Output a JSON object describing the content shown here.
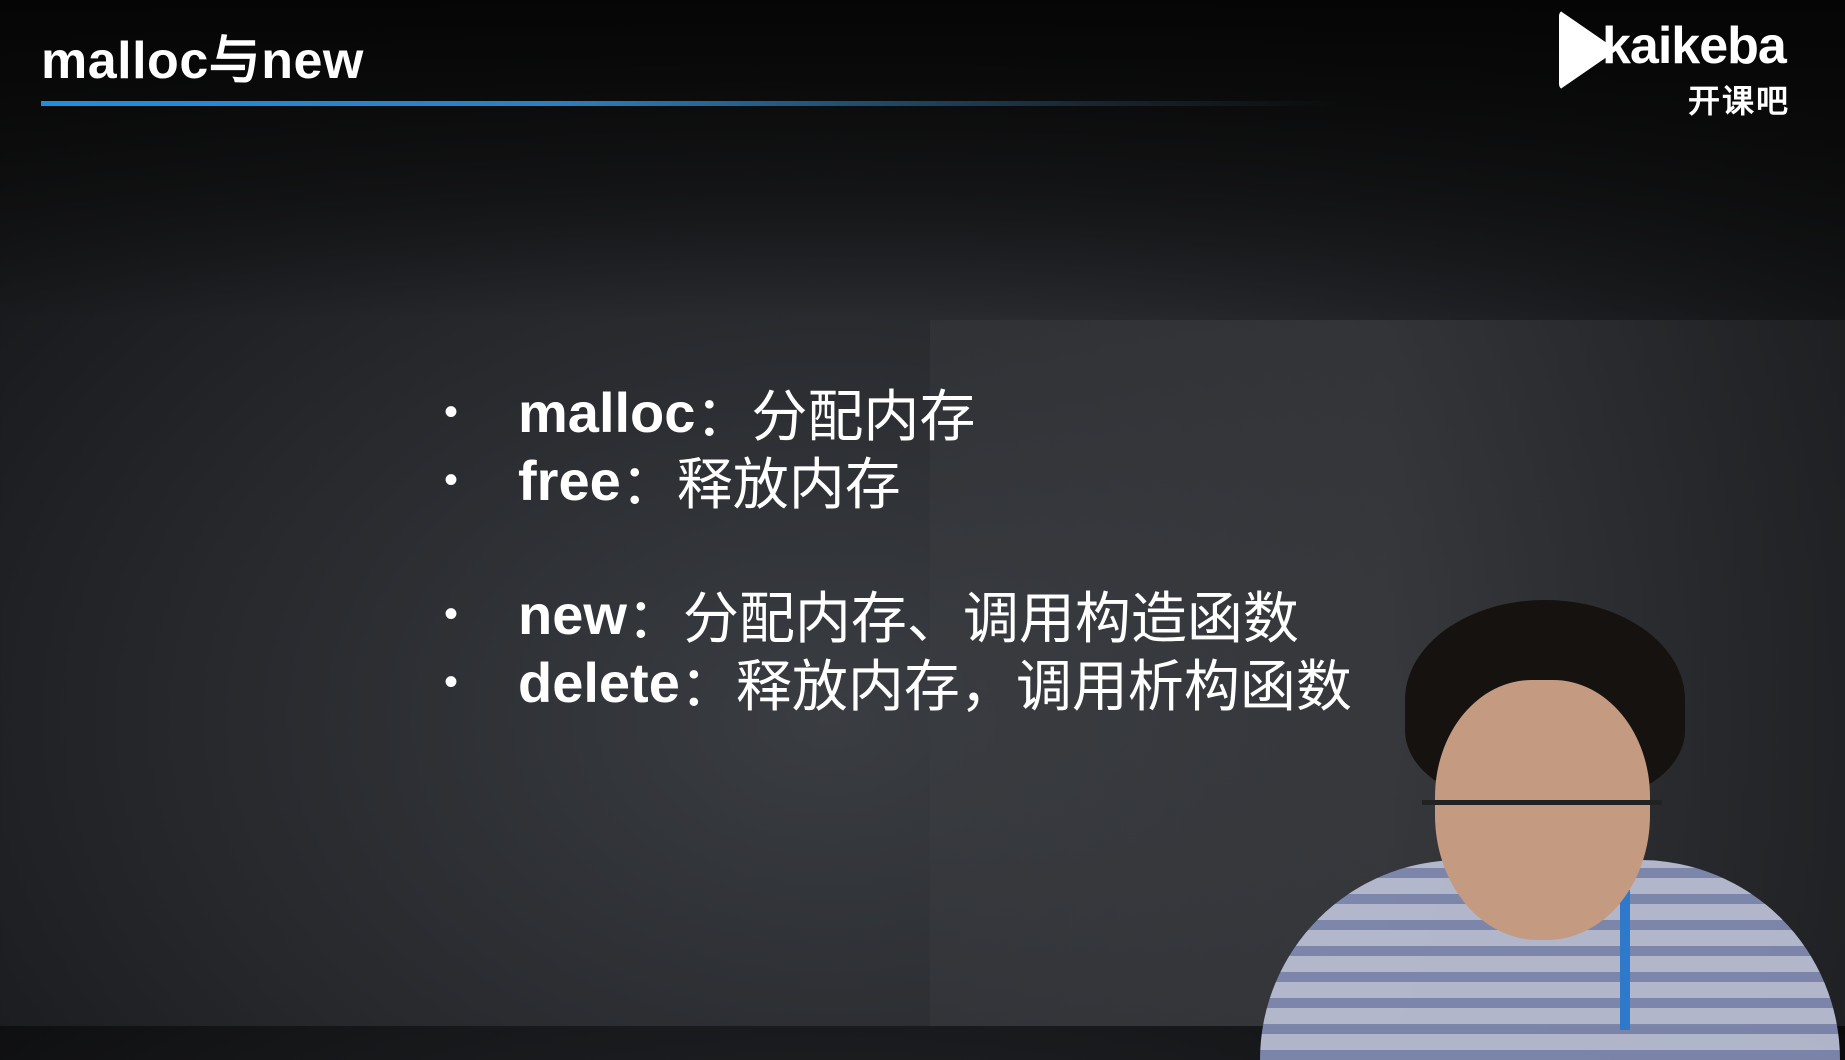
{
  "header": {
    "title": "malloc与new"
  },
  "logo": {
    "word": "kaikeba",
    "cn": "开课吧"
  },
  "bullets": [
    {
      "term": "malloc",
      "desc": "：分配内存"
    },
    {
      "term": "free",
      "desc": "：释放内存"
    },
    {
      "term": "new",
      "desc": "：分配内存、调用构造函数"
    },
    {
      "term": "delete",
      "desc": "：释放内存，调用析构函数"
    }
  ],
  "bullet_symbol": "•",
  "colors": {
    "accent": "#1e8fe0",
    "background": "#26282c"
  }
}
